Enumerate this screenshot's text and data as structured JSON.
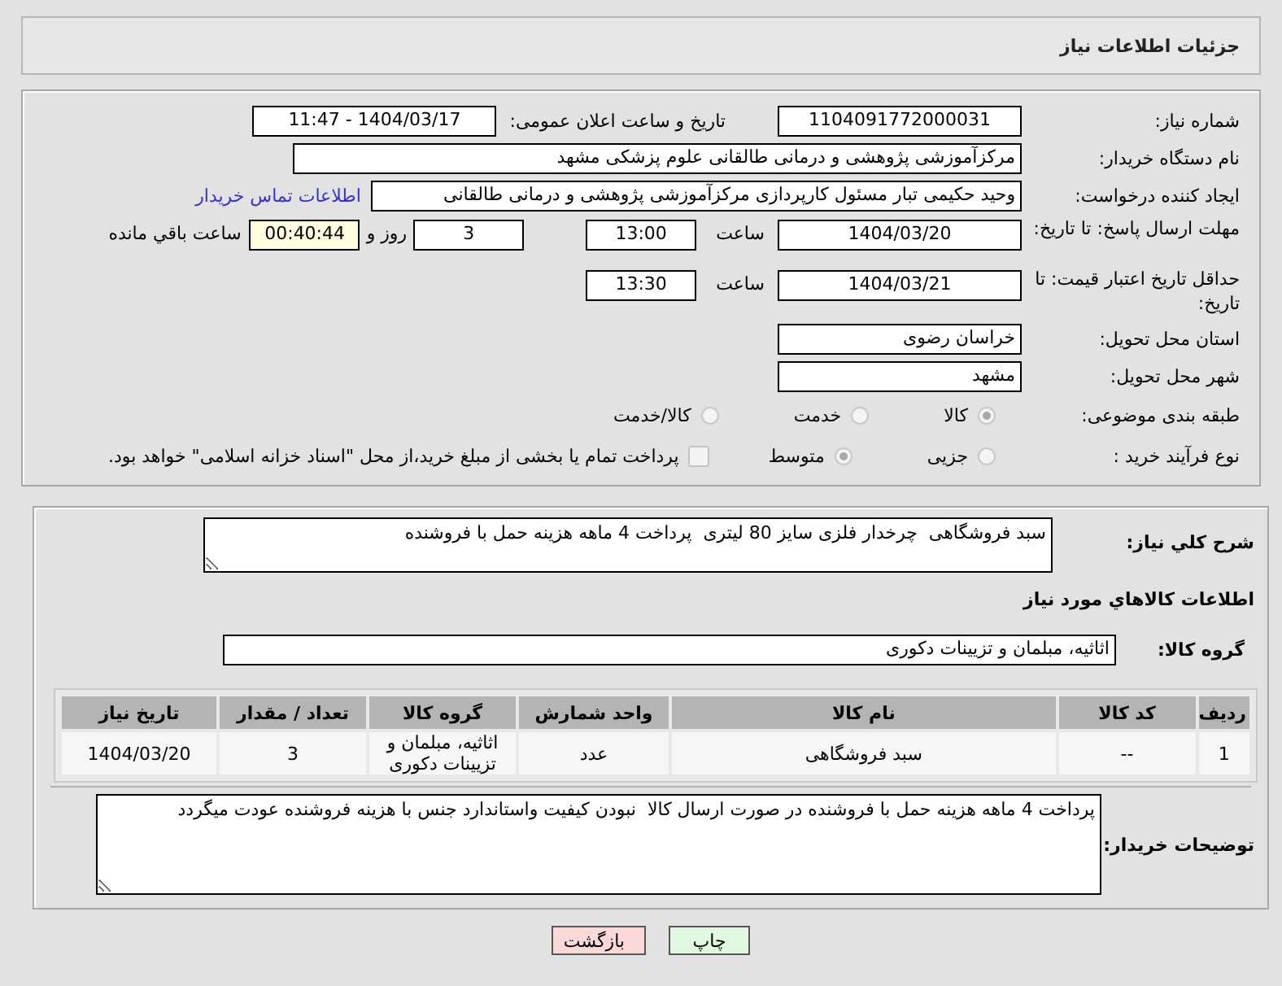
{
  "header": {
    "title": "جزئیات اطلاعات نیاز"
  },
  "need_number": {
    "label": "شماره نیاز:",
    "value": "1104091772000031"
  },
  "announce": {
    "label": "تاریخ و ساعت اعلان عمومی:",
    "value": "1404/03/17 - 11:47"
  },
  "buyer_org": {
    "label": "نام دستگاه خریدار:",
    "value": "مرکزآموزشی  پژوهشی و درمانی طالقانی   علوم پزشکی مشهد"
  },
  "requester": {
    "label": "ایجاد کننده درخواست:",
    "value": "وحید حکیمی تبار مسئول کارپردازی مرکزآموزشی  پژوهشی و درمانی طالقانی",
    "link": "اطلاعات تماس خریدار"
  },
  "response_deadline": {
    "label": "مهلت ارسال پاسخ: تا تاریخ:",
    "date": "1404/03/20",
    "time_label": "ساعت",
    "time": "13:00",
    "days": "3",
    "days_label": "روز و",
    "remaining": "00:40:44",
    "remaining_label": "ساعت باقي مانده"
  },
  "price_validity": {
    "label": "حداقل تاریخ اعتبار قیمت: تا تاریخ:",
    "date": "1404/03/21",
    "time_label": "ساعت",
    "time": "13:30"
  },
  "province": {
    "label": "استان محل تحویل:",
    "value": "خراسان رضوی"
  },
  "city": {
    "label": "شهر محل تحویل:",
    "value": "مشهد"
  },
  "category": {
    "label": "طبقه بندی موضوعی:",
    "options": [
      {
        "label": "کالا",
        "selected": true
      },
      {
        "label": "خدمت",
        "selected": false
      },
      {
        "label": "کالا/خدمت",
        "selected": false
      }
    ]
  },
  "purchase_process": {
    "label": "نوع فرآیند خرید :",
    "options": [
      {
        "label": "جزیی",
        "selected": false
      },
      {
        "label": "متوسط",
        "selected": true
      }
    ],
    "payment_option": {
      "label": "پرداخت تمام یا بخشی از مبلغ خرید،از محل \"اسناد خزانه اسلامی\" خواهد بود.",
      "checked": false
    }
  },
  "description": {
    "label": "شرح کلي نياز:",
    "value": "سبد فروشگاهی  چرخدار فلزی سایز 80 لیتری  پرداخت 4 ماهه هزینه حمل با فروشنده"
  },
  "goods_title": "اطلاعات کالاهاي مورد نياز",
  "goods_group": {
    "label": "گروه کالا:",
    "value": "اثاثیه، مبلمان و تزیینات دکوری"
  },
  "table": {
    "columns": [
      "رديف",
      "کد کالا",
      "نام کالا",
      "واحد شمارش",
      "گروه کالا",
      "تعداد / مقدار",
      "تاريخ نياز"
    ],
    "rows": [
      [
        "1",
        "--",
        "سبد فروشگاهی",
        "عدد",
        "اثاثیه، مبلمان و تزیینات دکوری",
        "3",
        "1404/03/20"
      ]
    ]
  },
  "buyer_notes": {
    "label": "توضیحات خریدار:",
    "value": "پرداخت 4 ماهه هزینه حمل با فروشنده در صورت ارسال کالا  نبودن کیفیت واستاندارد جنس با هزینه فروشنده عودت میگردد"
  },
  "buttons": [
    {
      "label": "چاپ",
      "kind": "print"
    },
    {
      "label": "بازگشت",
      "kind": "back"
    }
  ]
}
